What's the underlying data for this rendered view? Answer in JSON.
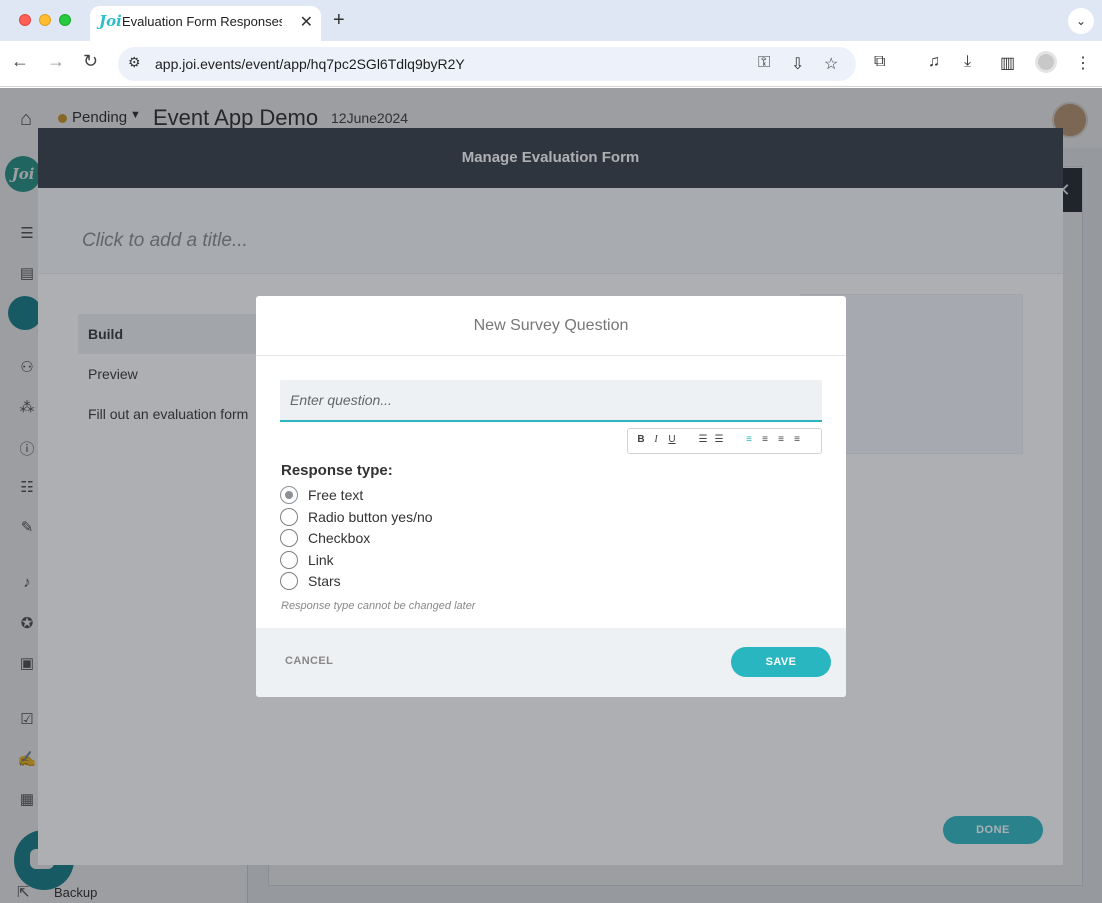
{
  "browser": {
    "tab_title": "Evaluation Form Responses |",
    "tab_favicon": "Joi",
    "tab_close": "✕",
    "new_tab": "+",
    "tab_menu": "⌄",
    "url": "app.joi.events/event/app/hq7pc2SGl6Tdlq9byR2Y",
    "icons": [
      "back-icon",
      "forward-icon",
      "reload-icon",
      "site-info-icon",
      "password-key-icon",
      "install-app-icon",
      "bookmark-star-icon",
      "extensions-icon",
      "media-controls-icon",
      "downloads-icon",
      "side-panel-icon",
      "profile-icon",
      "more-menu-icon"
    ]
  },
  "app": {
    "status": "Pending",
    "status_color": "#d9a12a",
    "event_title": "Event App Demo",
    "event_date": "12June2024",
    "logo_text": "Joi",
    "sidebar_backup": "Backup",
    "accent_color": "#2ab6c0"
  },
  "eval_modal": {
    "header_title": "Manage Evaluation Form",
    "title_placeholder": "Click to add a title...",
    "nav": [
      {
        "label": "Build",
        "active": true
      },
      {
        "label": "Preview",
        "active": false
      },
      {
        "label": "Fill out an evaluation form",
        "active": false
      }
    ],
    "done_label": "DONE"
  },
  "dialog": {
    "title": "New Survey Question",
    "question_placeholder": "Enter question...",
    "toolbar": [
      "bold",
      "italic",
      "underline",
      "ordered-list",
      "unordered-list",
      "align-left",
      "align-center",
      "align-right",
      "align-justify"
    ],
    "response_type_label": "Response type:",
    "options": [
      {
        "label": "Free text",
        "selected": true
      },
      {
        "label": "Radio button yes/no",
        "selected": false
      },
      {
        "label": "Checkbox",
        "selected": false
      },
      {
        "label": "Link",
        "selected": false
      },
      {
        "label": "Stars",
        "selected": false
      }
    ],
    "hint": "Response type cannot be changed later",
    "cancel_label": "CANCEL",
    "save_label": "SAVE"
  }
}
